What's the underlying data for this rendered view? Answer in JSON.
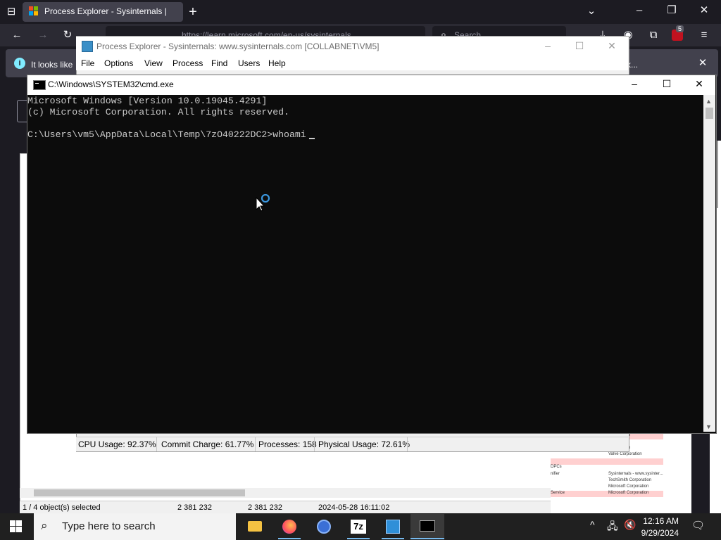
{
  "browser": {
    "tab_title": "Process Explorer - Sysinternals | ",
    "url": "https://learn.microsoft.com/en-us/sysinternals",
    "search_placeholder": "Search",
    "extension_badge": "5",
    "info_text": "It looks like",
    "info_more": "x..."
  },
  "process_explorer": {
    "title": "Process Explorer - Sysinternals: www.sysinternals.com [COLLABNET\\VM5]",
    "menu": [
      "File",
      "Options",
      "View",
      "Process",
      "Find",
      "Users",
      "Help"
    ],
    "status": {
      "cpu": "CPU Usage: 92.37%",
      "commit": "Commit Charge: 61.77%",
      "processes": "Processes: 158",
      "physical": "Physical Usage: 72.61%"
    },
    "lower_status": {
      "selected": "1 / 4 object(s) selected",
      "size1": "2 381 232",
      "size2": "2 381 232",
      "date": "2024-05-28 16:11:02"
    },
    "side_companies": [
      "Corporation",
      "Corporation",
      "Valve Corporation",
      "DPCs",
      "nifier",
      "Sysinternals - www.sysinter...",
      "TechSmith Corporation",
      "Microsoft Corporation",
      "Microsoft Corporation",
      "Service",
      "Microsoft Corporation"
    ]
  },
  "cmd": {
    "title": "C:\\Windows\\SYSTEM32\\cmd.exe",
    "lines": [
      "Microsoft Windows [Version 10.0.19045.4291]",
      "(c) Microsoft Corporation. All rights reserved.",
      "",
      "C:\\Users\\vm5\\AppData\\Local\\Temp\\7zO40222DC2>whoami"
    ]
  },
  "taskbar": {
    "search_placeholder": "Type here to search",
    "time": "12:16 AM",
    "date": "9/29/2024"
  },
  "colors": {
    "accent": "#0060df",
    "console_bg": "#0c0c0c",
    "console_text": "#cccccc"
  }
}
